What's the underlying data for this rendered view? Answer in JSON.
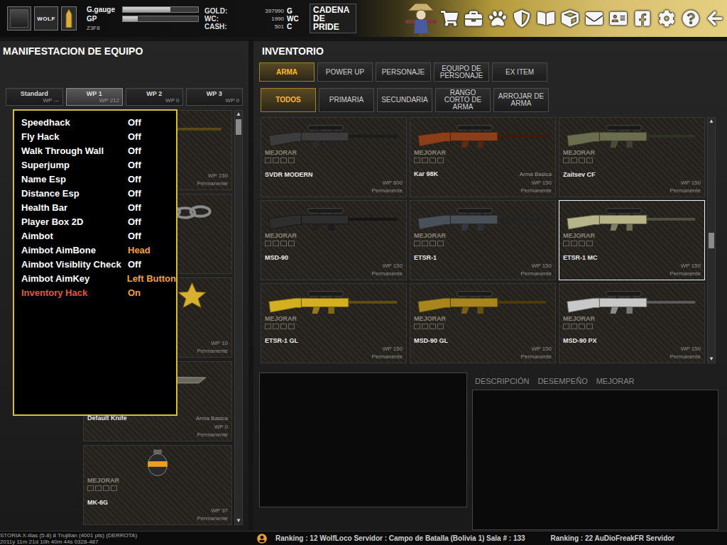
{
  "topbar": {
    "logo_text": "WOLF",
    "stats": [
      {
        "label": "G.gauge",
        "level": 0.63
      },
      {
        "label": "GP",
        "level": 0.2
      }
    ],
    "code": "Z3F8",
    "currencies": [
      {
        "label": "GOLD:",
        "value": "397990",
        "unit": "G"
      },
      {
        "label": "WC:",
        "value": "1990",
        "unit": "WC"
      },
      {
        "label": "CASH:",
        "value": "501",
        "unit": "C"
      }
    ],
    "title": "CADENA DE PRIDE"
  },
  "equipment": {
    "title": "MANIFESTACION DE EQUIPO",
    "tabs": [
      {
        "label": "Standard",
        "wp": "WP ---",
        "selected": false
      },
      {
        "label": "WP 1",
        "wp": "WP 212",
        "selected": true
      },
      {
        "label": "WP 2",
        "wp": "WP 0",
        "selected": false
      },
      {
        "label": "WP 3",
        "wp": "WP 0",
        "selected": false
      }
    ],
    "slots": [
      {
        "kind": "rifle",
        "color": "#c9a227",
        "wp": "WP 150",
        "duration": "Permanente"
      },
      {
        "kind": "chain",
        "color": "#8a8a8a"
      },
      {
        "kind": "star",
        "color": "#d8b030",
        "wp": "WP 10",
        "duration": "Permanente"
      },
      {
        "kind": "knife",
        "color": "#6a6a5a",
        "name": "Default Knife",
        "info": "Arma Basica",
        "wp": "WP 0",
        "duration": "Permanente"
      },
      {
        "kind": "grenade",
        "color": "#e8a020",
        "upgrade_label": "MEJORAR",
        "name": "MK-6G",
        "wp": "WP 37",
        "duration": "Permanente"
      }
    ],
    "scroll_up": "▲",
    "scroll_down": "▼"
  },
  "hack_menu": {
    "items": [
      {
        "label": "Speedhack",
        "value": "Off",
        "kind": "toggle",
        "on": false,
        "selected": false
      },
      {
        "label": "Fly Hack",
        "value": "Off",
        "kind": "toggle",
        "on": false,
        "selected": false
      },
      {
        "label": "Walk Through Wall",
        "value": "Off",
        "kind": "toggle",
        "on": false,
        "selected": false
      },
      {
        "label": "Superjump",
        "value": "Off",
        "kind": "toggle",
        "on": false,
        "selected": false
      },
      {
        "label": "Name Esp",
        "value": "Off",
        "kind": "toggle",
        "on": false,
        "selected": false
      },
      {
        "label": "Distance Esp",
        "value": "Off",
        "kind": "toggle",
        "on": false,
        "selected": false
      },
      {
        "label": "Health Bar",
        "value": "Off",
        "kind": "toggle",
        "on": false,
        "selected": false
      },
      {
        "label": "Player Box 2D",
        "value": "Off",
        "kind": "toggle",
        "on": false,
        "selected": false
      },
      {
        "label": "Aimbot",
        "value": "Off",
        "kind": "toggle",
        "on": false,
        "selected": false
      },
      {
        "label": "Aimbot AimBone",
        "value": "Head",
        "kind": "option",
        "on": false,
        "selected": false
      },
      {
        "label": "Aimbot Visiblity Check",
        "value": "Off",
        "kind": "toggle",
        "on": false,
        "selected": false
      },
      {
        "label": "Aimbot AimKey",
        "value": "Left Button",
        "kind": "option",
        "on": false,
        "selected": false
      },
      {
        "label": "Inventory Hack",
        "value": "On",
        "kind": "toggle",
        "on": true,
        "selected": true
      }
    ]
  },
  "inventory": {
    "title": "INVENTORIO",
    "main_tabs": [
      {
        "label": "ARMA",
        "selected": true
      },
      {
        "label": "POWER UP",
        "selected": false
      },
      {
        "label": "PERSONAJE",
        "selected": false
      },
      {
        "label": "EQUIPO DE PERSONAJE",
        "selected": false
      },
      {
        "label": "EX ITEM",
        "selected": false
      }
    ],
    "sub_tabs": [
      {
        "label": "TODOS",
        "selected": true
      },
      {
        "label": "PRIMARIA",
        "selected": false
      },
      {
        "label": "SECUNDARIA",
        "selected": false
      },
      {
        "label": "RANGO CORTO DE ARMA",
        "selected": false
      },
      {
        "label": "ARROJAR DE ARMA",
        "selected": false
      }
    ],
    "items": [
      {
        "name": "SVDR MODERN",
        "upgrade_label": "MEJORAR",
        "wp": "WP 600",
        "duration": "Permanente",
        "color": "#3c3c3c",
        "selected": false
      },
      {
        "name": "Kar 98K",
        "upgrade_label": "MEJORAR",
        "info": "Arma Basica",
        "wp": "WP 150",
        "duration": "Permanente",
        "color": "#8a3e1a",
        "selected": false
      },
      {
        "name": "Zaitsev CF",
        "upgrade_label": "MEJORAR",
        "wp": "WP 150",
        "duration": "Permanente",
        "color": "#6b6e4e",
        "selected": false
      },
      {
        "name": "MSD-90",
        "upgrade_label": "MEJORAR",
        "wp": "WP 150",
        "duration": "Permanente",
        "color": "#2e2e2e",
        "selected": false
      },
      {
        "name": "ETSR-1",
        "upgrade_label": "MEJORAR",
        "wp": "WP 150",
        "duration": "Permanente",
        "color": "#4a5058",
        "selected": false
      },
      {
        "name": "ETSR-1 MC",
        "upgrade_label": "MEJORAR",
        "wp": "WP 150",
        "duration": "Permanente",
        "color": "#b8b48a",
        "selected": true
      },
      {
        "name": "ETSR-1 GL",
        "upgrade_label": "MEJORAR",
        "wp": "WP 150",
        "duration": "Permanente",
        "color": "#d4b020",
        "selected": false
      },
      {
        "name": "MSD-90 GL",
        "upgrade_label": "MEJORAR",
        "wp": "WP 150",
        "duration": "Permanente",
        "color": "#a8861c",
        "selected": false
      },
      {
        "name": "MSD-90 PX",
        "upgrade_label": "MEJORAR",
        "wp": "WP 150",
        "duration": "Permanente",
        "color": "#c8c8c8",
        "selected": false
      }
    ],
    "scroll_up": "▲",
    "scroll_down": "▼",
    "detail_tabs": [
      {
        "label": "DESCRIPCIÓN",
        "selected": false
      },
      {
        "label": "DESEMPEÑO",
        "selected": false
      },
      {
        "label": "MEJORAR",
        "selected": false
      }
    ]
  },
  "status_bar": {
    "history": [
      "STORIA X-illas (5-8) 8 Trujillan (4001 pts) (DERROTA)",
      "2011y 11m 21d 10h 40m 44s 0328-487"
    ],
    "tickers": [
      "Ranking : 12 WolfLoco Servidor : Campo de Batalla (Bolivia 1) Sala # : 133",
      "Ranking : 22 AuDioFreakFR Servidor"
    ]
  }
}
